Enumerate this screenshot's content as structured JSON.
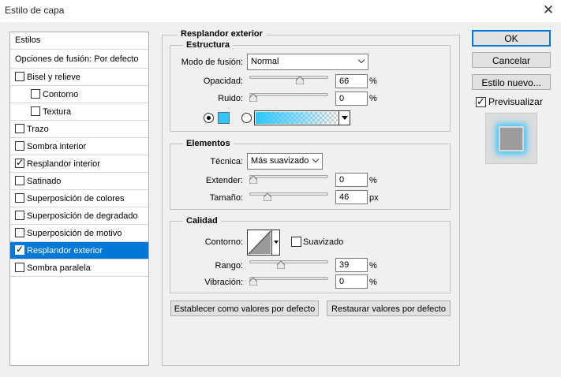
{
  "window": {
    "title": "Estilo de capa"
  },
  "left": {
    "header": "Estilos",
    "blend": "Opciones de fusión: Por defecto",
    "items": [
      {
        "label": "Bisel y relieve",
        "checked": false
      },
      {
        "label": "Contorno",
        "checked": false
      },
      {
        "label": "Textura",
        "checked": false
      },
      {
        "label": "Trazo",
        "checked": false
      },
      {
        "label": "Sombra interior",
        "checked": false
      },
      {
        "label": "Resplandor interior",
        "checked": true
      },
      {
        "label": "Satinado",
        "checked": false
      },
      {
        "label": "Superposición de colores",
        "checked": false
      },
      {
        "label": "Superposición de degradado",
        "checked": false
      },
      {
        "label": "Superposición de motivo",
        "checked": false
      },
      {
        "label": "Resplandor exterior",
        "checked": true,
        "selected": true
      },
      {
        "label": "Sombra paralela",
        "checked": false
      }
    ]
  },
  "panel": {
    "title": "Resplandor exterior",
    "structure": {
      "title": "Estructura",
      "blend_mode_label": "Modo de fusión:",
      "blend_mode_value": "Normal",
      "opacity_label": "Opacidad:",
      "opacity_value": "66",
      "opacity_unit": "%",
      "opacity_fraction": 0.66,
      "noise_label": "Ruido:",
      "noise_value": "0",
      "noise_unit": "%",
      "noise_fraction": 0.0,
      "color": "#2ec7ff"
    },
    "elements": {
      "title": "Elementos",
      "technique_label": "Técnica:",
      "technique_value": "Más suavizado",
      "spread_label": "Extender:",
      "spread_value": "0",
      "spread_unit": "%",
      "spread_fraction": 0.0,
      "size_label": "Tamaño:",
      "size_value": "46",
      "size_unit": "px",
      "size_fraction": 0.2
    },
    "quality": {
      "title": "Calidad",
      "contour_label": "Contorno:",
      "antialias_label": "Suavizado",
      "range_label": "Rango:",
      "range_value": "39",
      "range_unit": "%",
      "range_fraction": 0.39,
      "jitter_label": "Vibración:",
      "jitter_value": "0",
      "jitter_unit": "%",
      "jitter_fraction": 0.0
    },
    "default_button": "Establecer como valores por defecto",
    "reset_button": "Restaurar valores por defecto"
  },
  "right": {
    "ok": "OK",
    "cancel": "Cancelar",
    "new_style": "Estilo nuevo...",
    "preview_label": "Previsualizar",
    "preview_checked": true
  }
}
